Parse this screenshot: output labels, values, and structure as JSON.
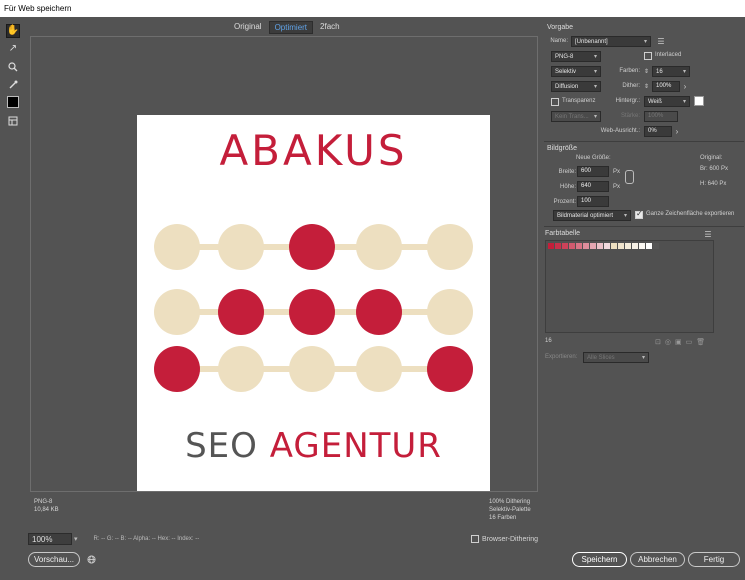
{
  "window": {
    "title": "Für Web speichern"
  },
  "tools": [
    {
      "icon": "hand-icon",
      "glyph": "✋"
    },
    {
      "icon": "slice-select-icon",
      "glyph": "↗"
    },
    {
      "icon": "zoom-icon",
      "glyph": "🔍"
    },
    {
      "icon": "eyedropper-icon",
      "glyph": "⊘"
    },
    {
      "icon": "eyedropper-color-swatch",
      "glyph": ""
    },
    {
      "icon": "toggle-slices-icon",
      "glyph": "▤"
    }
  ],
  "view_tabs": [
    {
      "label": "Original",
      "active": false
    },
    {
      "label": "Optimiert",
      "active": true
    },
    {
      "label": "2fach",
      "active": false
    }
  ],
  "logo": {
    "title": "ABAKUS",
    "sub_gray": "SEO",
    "sub_red": "AGENTUR",
    "colors": {
      "red": "#c41e3a",
      "beige": "#eddfc0",
      "gray": "#555555"
    },
    "rows": [
      [
        "beige",
        "beige",
        "red",
        "beige",
        "beige"
      ],
      [
        "beige",
        "red",
        "red",
        "red",
        "beige"
      ],
      [
        "red",
        "beige",
        "beige",
        "beige",
        "red"
      ]
    ]
  },
  "info": {
    "format": "PNG-8",
    "size": "10,84 KB",
    "dithering": "100% Dithering",
    "palette": "Selektiv-Palette",
    "colors": "16 Farben"
  },
  "status": {
    "zoom": "100%",
    "readouts": "R: --  G: --  B: --  Alpha: --  Hex: --  Index: --",
    "browser_dithering": "Browser-Dithering"
  },
  "buttons": {
    "preview": "Vorschau...",
    "save": "Speichern",
    "cancel": "Abbrechen",
    "done": "Fertig"
  },
  "preset": {
    "section": "Vorgabe",
    "name_label": "Name:",
    "name_value": "[Unbenannt]",
    "format": "PNG-8",
    "interlaced": "Interlaced",
    "reduction": "Selektiv",
    "colors_label": "Farben:",
    "colors_value": "16",
    "dither_algo": "Diffusion",
    "dither_label": "Dither:",
    "dither_value": "100%",
    "transparency": "Transparenz",
    "matte_label": "Hintergr.:",
    "matte_value": "Weiß",
    "transp_dither": "Kein Trans...",
    "amount_label": "Stärke:",
    "amount_value": "100%",
    "websnap_label": "Web-Ausricht.:",
    "websnap_value": "0%"
  },
  "image_size": {
    "section": "Bildgröße",
    "new_size": "Neue Größe:",
    "original": "Original:",
    "width_label": "Breite:",
    "width_value": "600",
    "height_label": "Höhe:",
    "height_value": "640",
    "unit": "Px",
    "percent_label": "Prozent:",
    "percent_value": "100",
    "orig_w": "Br:  600 Px",
    "orig_h": "H:  640 Px",
    "quality": "Bildmaterial optimiert",
    "clip_artboard": "Ganze Zeichenfläche exportieren"
  },
  "color_table": {
    "section": "Farbtabelle",
    "count": "16",
    "swatches": [
      "#c41e3a",
      "#c8304a",
      "#cc4259",
      "#d05a6e",
      "#d77485",
      "#dd8d9b",
      "#e4a6b1",
      "#eac0c7",
      "#f0d8dc",
      "#eddfc0",
      "#f0e4cc",
      "#f4ecda",
      "#f7f1e6",
      "#fbf8f3",
      "#ffffff",
      "#555555"
    ]
  },
  "export": {
    "label": "Exportieren:",
    "value": "Alle Slices"
  }
}
